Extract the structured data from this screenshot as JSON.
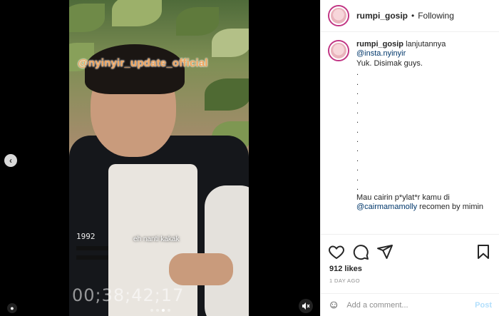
{
  "media": {
    "watermark": "@nyinyir_update_official",
    "caption": "eh nanti kakak",
    "shirt_number": "1992",
    "timecode": "00;38;42;17",
    "slide_count": 4,
    "active_slide": 3,
    "prev_icon": "chevron-left-icon",
    "user_tag_icon": "user-icon",
    "mute_icon": "speaker-muted-icon"
  },
  "panel": {
    "header": {
      "username": "rumpi_gosip",
      "separator": "•",
      "follow_status": "Following"
    },
    "comment": {
      "username": "rumpi_gosip",
      "text_start": " lanjutannya",
      "mention1": "@insta.nyinyir",
      "line2": "Yuk. Disimak guys.",
      "dots": [
        ".",
        ".",
        ".",
        ".",
        ".",
        ".",
        ".",
        ".",
        ".",
        ".",
        ".",
        ".",
        "."
      ],
      "line3": "Mau cairin p*ylat*r kamu di",
      "mention2": "@cairmamamolly",
      "line4_rest": " recomen by mimin"
    },
    "actions": {
      "likes": "912 likes",
      "age": "1 DAY AGO"
    },
    "comment_box": {
      "placeholder": "Add a comment...",
      "post_label": "Post"
    }
  }
}
